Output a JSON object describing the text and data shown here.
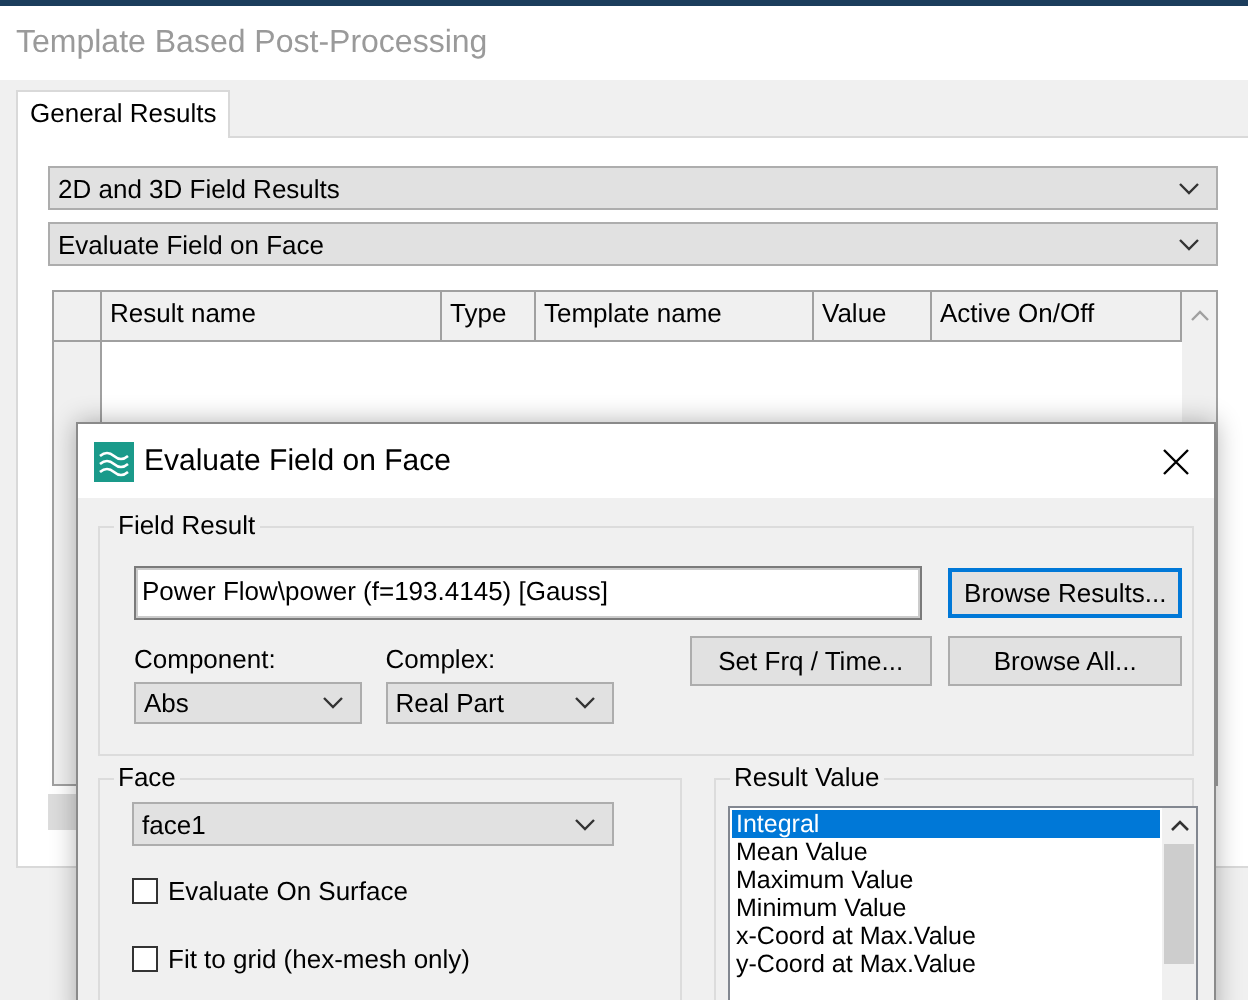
{
  "main_window": {
    "title": "Template Based Post-Processing",
    "tabs": [
      {
        "label": "General Results",
        "selected": true
      }
    ],
    "category_select": {
      "value": "2D and 3D Field Results"
    },
    "template_select": {
      "value": "Evaluate Field on Face"
    },
    "table": {
      "columns": [
        "Result name",
        "Type",
        "Template name",
        "Value",
        "Active On/Off"
      ]
    }
  },
  "dialog": {
    "title": "Evaluate Field on Face",
    "field_result": {
      "label": "Field Result",
      "value": "Power Flow\\power (f=193.4145) [Gauss]",
      "browse_results": {
        "label": "Browse Results...",
        "default": true
      },
      "component": {
        "label": "Component:",
        "value": "Abs"
      },
      "complex": {
        "label": "Complex:",
        "value": "Real Part"
      },
      "set_frequency": {
        "label": "Set Frq / Time..."
      },
      "browse_all": {
        "label": "Browse All...",
        "default": false
      }
    },
    "face": {
      "label": "Face",
      "value": "face1",
      "options": [
        {
          "label": "Evaluate On Surface",
          "checked": false
        },
        {
          "label": "Fit to grid (hex-mesh only)",
          "checked": false
        }
      ]
    },
    "result_value": {
      "label": "Result Value",
      "items": [
        {
          "label": "Integral",
          "selected": true
        },
        {
          "label": "Mean Value",
          "selected": false
        },
        {
          "label": "Maximum Value",
          "selected": false
        },
        {
          "label": "Minimum Value",
          "selected": false
        },
        {
          "label": "x-Coord at Max.Value",
          "selected": false
        },
        {
          "label": "y-Coord at Max.Value",
          "selected": false
        }
      ]
    }
  }
}
